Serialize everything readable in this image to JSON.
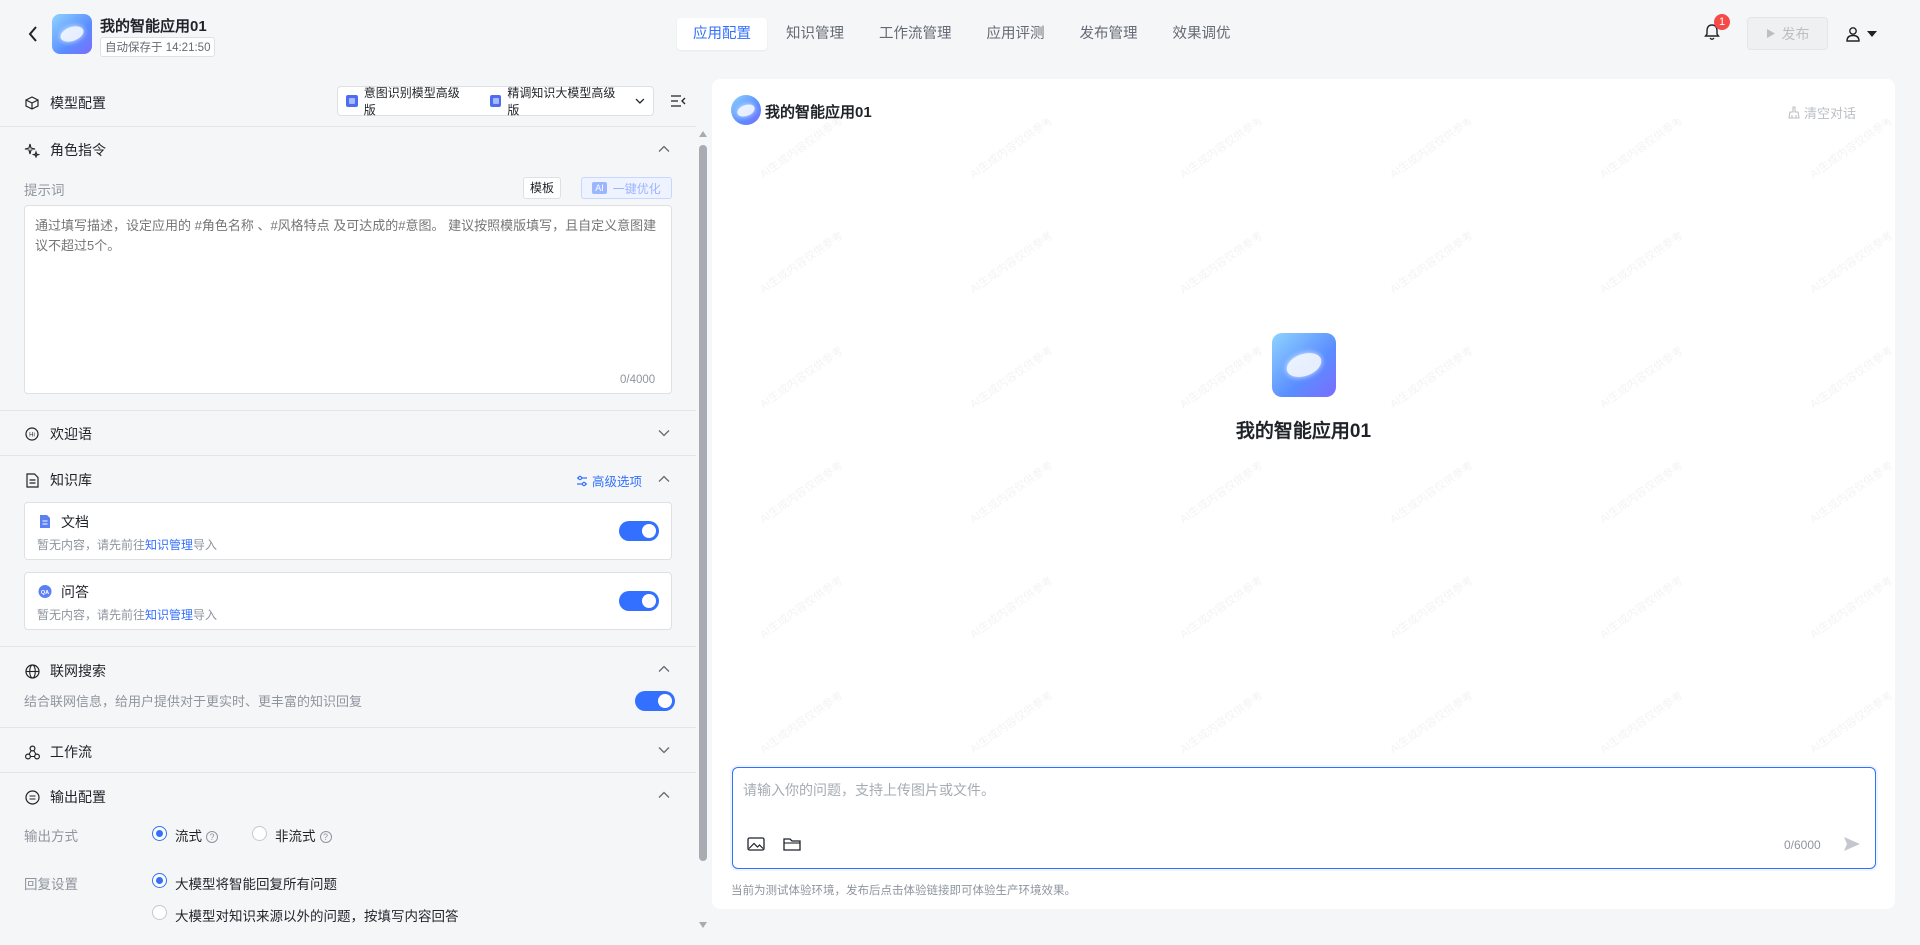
{
  "header": {
    "app_name": "我的智能应用01",
    "autosave": "自动保存于 14:21:50",
    "tabs": [
      "应用配置",
      "知识管理",
      "工作流管理",
      "应用评测",
      "发布管理",
      "效果调优"
    ],
    "active_tab": 0,
    "notification_count": "1",
    "publish_label": "发布"
  },
  "model_config": {
    "title": "模型配置",
    "model_1": "意图识别模型高级版",
    "model_2": "精调知识大模型高级版"
  },
  "role": {
    "title": "角色指令",
    "prompt_label": "提示词",
    "template_btn": "模板",
    "ai_chip": "AI",
    "optimize_btn": "一键优化",
    "placeholder": "通过填写描述，设定应用的 #角色名称 、#风格特点 及可达成的#意图。 建议按照模版填写，且自定义意图建议不超过5个。",
    "count": "0/4000"
  },
  "welcome": {
    "title": "欢迎语"
  },
  "knowledge": {
    "title": "知识库",
    "advanced": "高级选项",
    "items": [
      {
        "title": "文档",
        "sub_pre": "暂无内容，请先前往",
        "sub_link": "知识管理",
        "sub_post": "导入",
        "enabled": true
      },
      {
        "title": "问答",
        "sub_pre": "暂无内容，请先前往",
        "sub_link": "知识管理",
        "sub_post": "导入",
        "enabled": true
      }
    ]
  },
  "web_search": {
    "title": "联网搜索",
    "desc": "结合联网信息，给用户提供对于更实时、更丰富的知识回复",
    "enabled": true
  },
  "workflow": {
    "title": "工作流"
  },
  "output": {
    "title": "输出配置",
    "mode_label": "输出方式",
    "mode_options": [
      "流式",
      "非流式"
    ],
    "mode_selected": "流式",
    "reply_label": "回复设置",
    "reply_options": [
      "大模型将智能回复所有问题",
      "大模型对知识来源以外的问题，按填写内容回答"
    ],
    "reply_selected": "大模型将智能回复所有问题"
  },
  "chat": {
    "title": "我的智能应用01",
    "clear": "清空对话",
    "center_title": "我的智能应用01",
    "watermark": "AI生成内容仅供参考",
    "input_placeholder": "请输入你的问题，支持上传图片或文件。",
    "count": "0/6000",
    "footnote": "当前为测试体验环境，发布后点击体验链接即可体验生产环境效果。"
  },
  "colors": {
    "accent": "#3370ff",
    "badge": "#f54a45",
    "text": "#1f2329",
    "muted": "#8f959e"
  }
}
